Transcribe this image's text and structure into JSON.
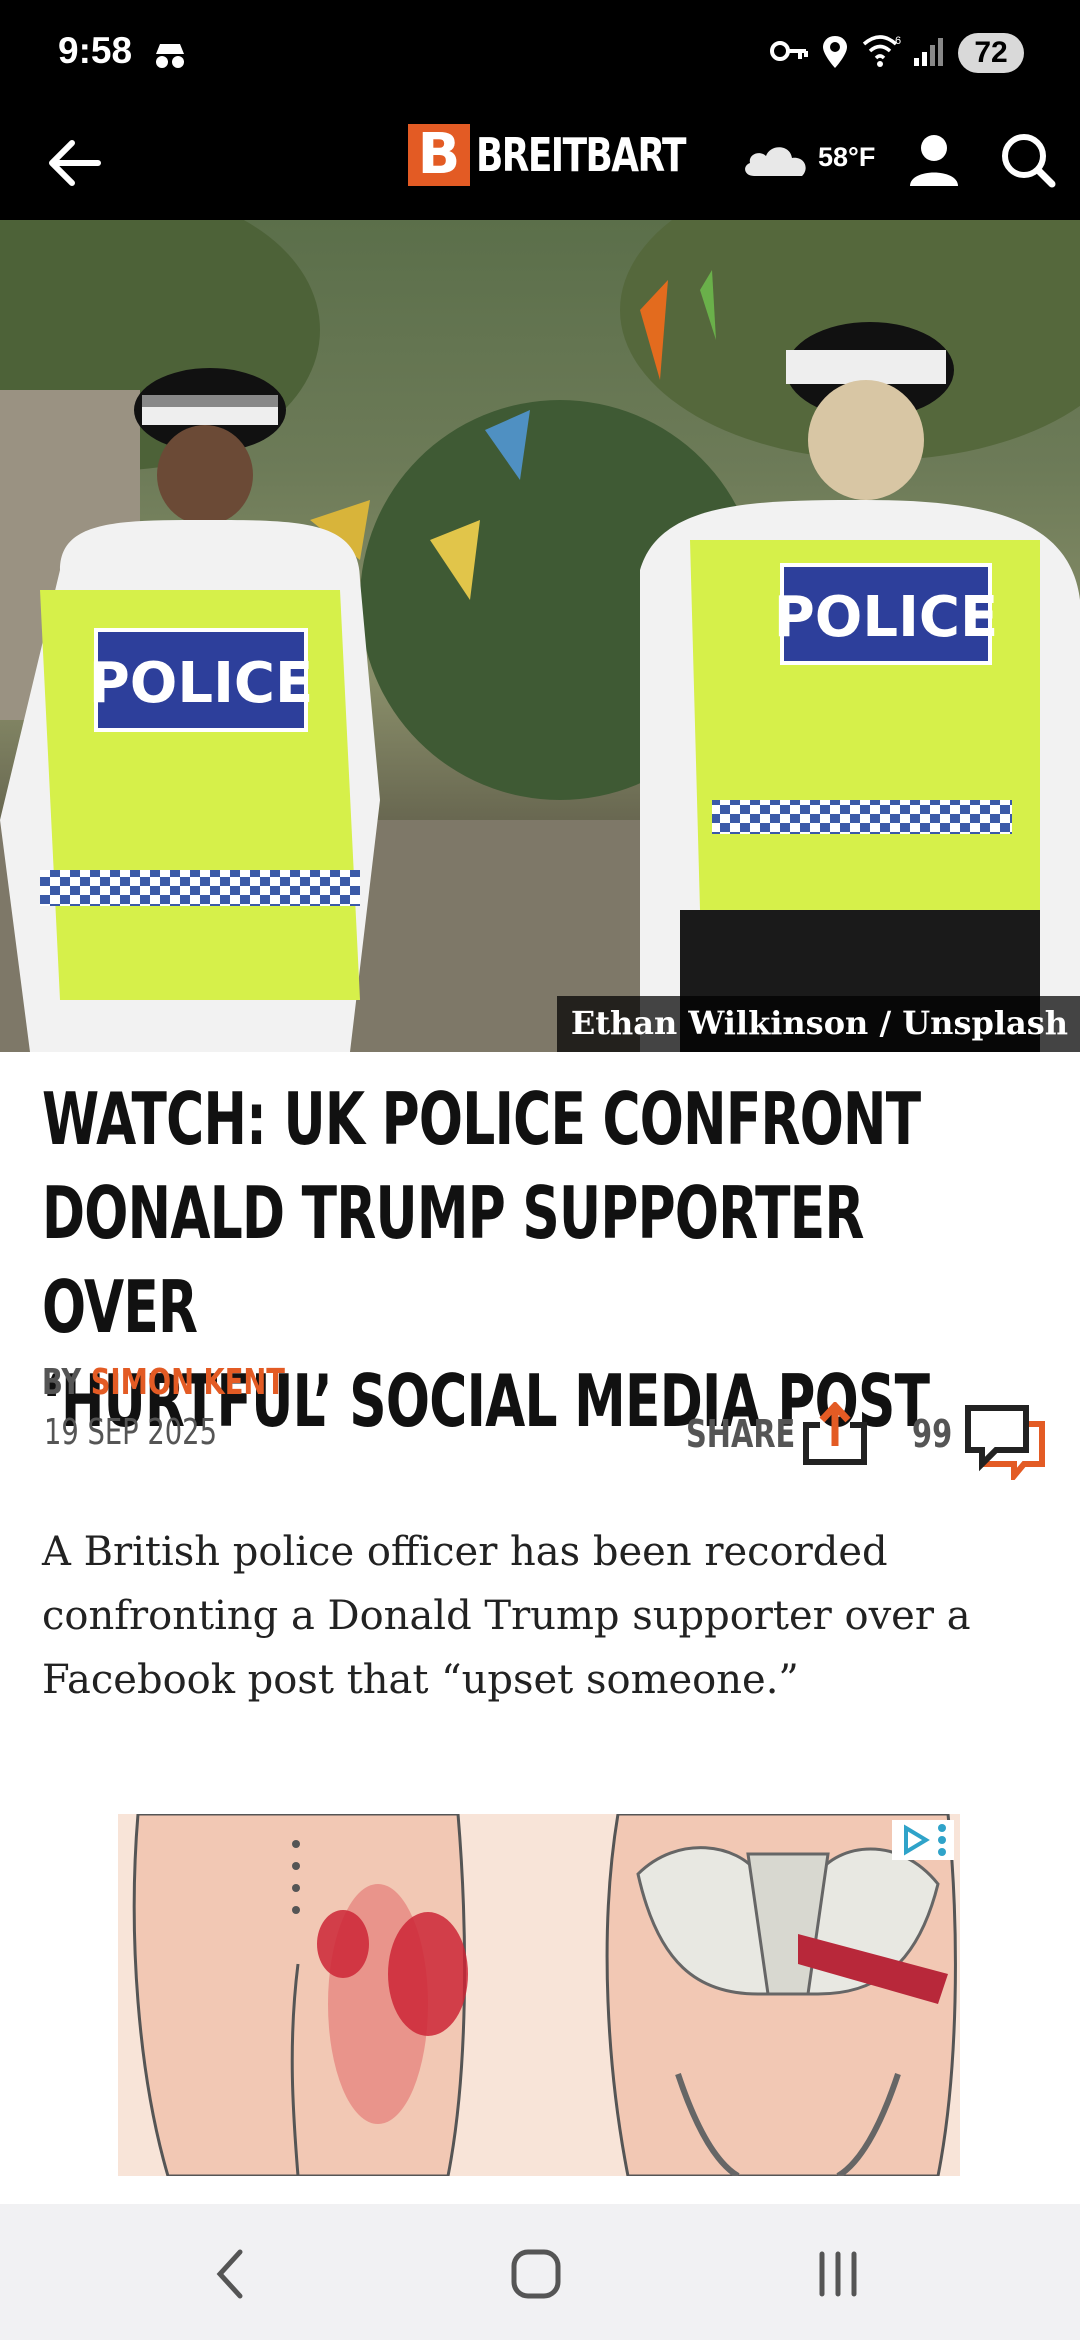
{
  "status_bar": {
    "time": "9:58",
    "battery": "72",
    "icons": [
      "incognito-icon",
      "vpn-key-icon",
      "location-icon",
      "wifi-6-icon",
      "signal-icon",
      "battery-icon"
    ]
  },
  "header": {
    "brand_letter": "B",
    "brand_name": "BREITBART",
    "temperature": "58°F",
    "icons": [
      "back-arrow-icon",
      "cloud-icon",
      "user-icon",
      "search-icon"
    ],
    "brand_color": "#e35b24"
  },
  "hero": {
    "photo_credit": "Ethan Wilkinson / Unsplash",
    "vest_text": "POLICE"
  },
  "article": {
    "headline_line1": "WATCH: UK POLICE CONFRONT",
    "headline_line2": "DONALD TRUMP SUPPORTER OVER",
    "headline_line3": "‘HURTFUL’ SOCIAL MEDIA POST",
    "by_label": "BY",
    "author": "SIMON KENT",
    "date": "19 SEP 2025",
    "share_label": "SHARE",
    "comment_count": "99",
    "lede": "A British police officer has been recorded confronting a Donald Trump supporter over a Facebook post that “upset someone.”"
  },
  "ad": {
    "icons": [
      "adchoices-icon",
      "ad-menu-icon"
    ]
  },
  "nav_bar": {
    "icons": [
      "nav-back-icon",
      "nav-home-icon",
      "nav-recents-icon"
    ]
  }
}
